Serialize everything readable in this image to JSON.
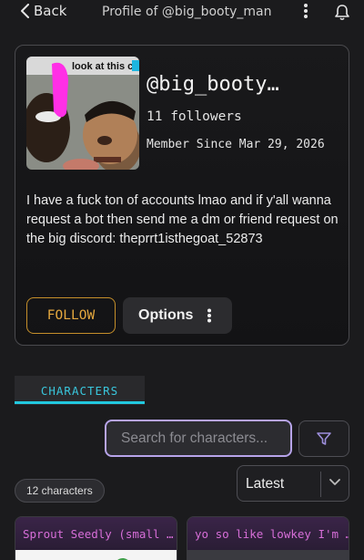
{
  "header": {
    "back_label": "Back",
    "title": "Profile of @big_booty_man"
  },
  "profile": {
    "avatar_caption": "look at this c",
    "username": "@big_booty…",
    "followers": "11 followers",
    "member_since": "Member Since Mar 29, 2026",
    "bio": "I have a fuck ton of accounts lmao and if y'all wanna request a bot then send me a dm or friend request on the big discord: theprrt1isthegoat_52873",
    "follow_label": "FOLLOW",
    "options_label": "Options"
  },
  "tabs": {
    "active": "CHARACTERS"
  },
  "search": {
    "placeholder": "Search for characters..."
  },
  "list": {
    "count": "12 characters",
    "sort_value": "Latest"
  },
  "characters": [
    {
      "name": "Sprout Seedly (small …"
    },
    {
      "name": "yo so like lowkey I'm …"
    }
  ],
  "colors": {
    "accent_cyan": "#22c8de",
    "follow_gold": "#e6a93f",
    "search_border": "#b7a4ea",
    "char_title": "#d76ed8"
  }
}
